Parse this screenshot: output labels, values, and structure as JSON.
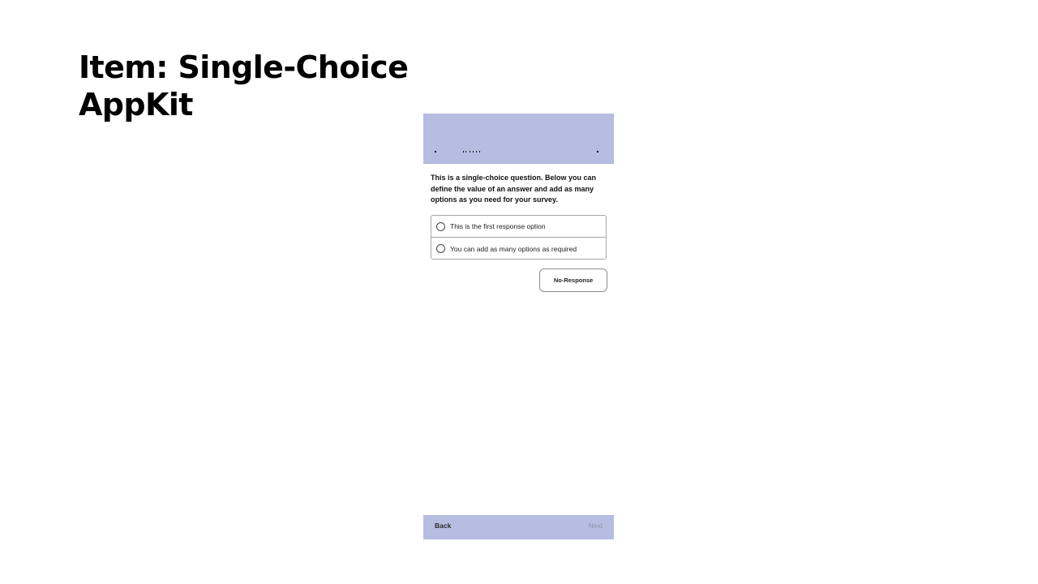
{
  "slide": {
    "title_line1": "Item: Single-Choice",
    "title_line2": "AppKit"
  },
  "question": {
    "text": "This is a single-choice question. Below you can define the value of an answer and add as many options as you need for your survey."
  },
  "options": [
    {
      "label": "This is the first response option",
      "selected": false
    },
    {
      "label": "You can add as many options as required",
      "selected": false
    }
  ],
  "buttons": {
    "no_response": "No-Response",
    "back": "Back",
    "next": "Next"
  },
  "colors": {
    "header_bar": "#b6bde1",
    "footer_bar": "#b6bde1",
    "next_disabled_text": "#8f93a8",
    "option_border": "#a7a7a7"
  }
}
